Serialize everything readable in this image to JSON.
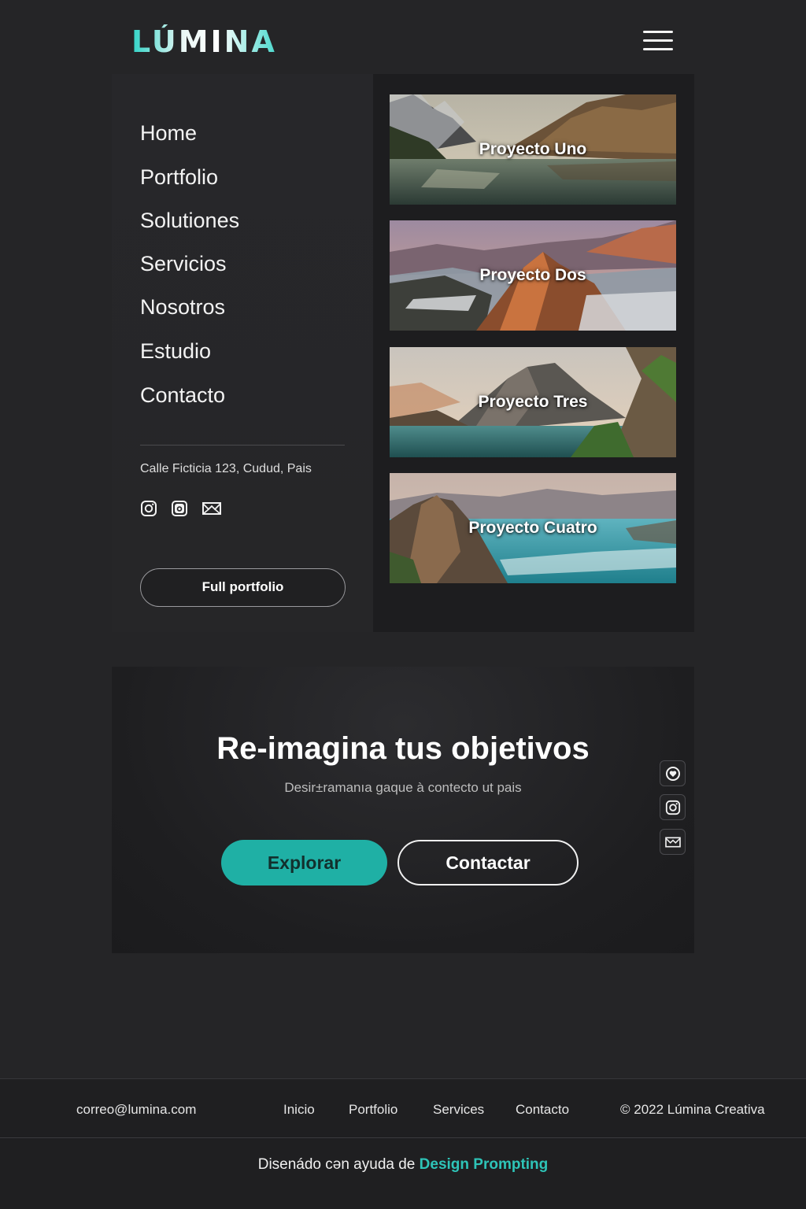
{
  "header": {
    "logo": "LÚMINA",
    "menu_icon": "hamburger-menu-icon"
  },
  "nav": {
    "items": [
      "Home",
      "Portfolio",
      "Solutiones",
      "Servicios",
      "Nosotros",
      "Estudio",
      "Contacto"
    ],
    "address": "Calle Ficticia 123, Cudud, Pais",
    "social_icons": [
      "instagram-icon",
      "camera-icon",
      "mail-icon"
    ],
    "full_portfolio_label": "Full portfolio"
  },
  "gallery": {
    "projects": [
      {
        "title": "Proyecto Uno",
        "image": "mountain-lake-photo"
      },
      {
        "title": "Proyecto Dos",
        "image": "sunset-peaks-photo"
      },
      {
        "title": "Proyecto Tres",
        "image": "fjord-mountain-photo"
      },
      {
        "title": "Proyecto Cuatro",
        "image": "coastal-cliffs-photo"
      }
    ]
  },
  "hero": {
    "title": "Re-imagina tus objetivos",
    "subtitle": "Desir±ramanıa gaque à contecto ut pais",
    "explore_label": "Explorar",
    "contact_label": "Contactar",
    "side_icons": [
      "heart-badge-icon",
      "instagram-icon",
      "mail-icon"
    ]
  },
  "footer": {
    "email": "correo@lumina.com",
    "links": [
      "Inicio",
      "Portfolio",
      "Services",
      "Contacto"
    ],
    "copyright": "© 2022 Lúmina Creativa",
    "credit_prefix": "Disenádo cən ayuda de",
    "credit_link": "Design Prompting"
  },
  "colors": {
    "background": "#252527",
    "accent": "#1fb0a5",
    "logo_accent": "#2fd3c6",
    "panel": "#1d1d1f"
  }
}
